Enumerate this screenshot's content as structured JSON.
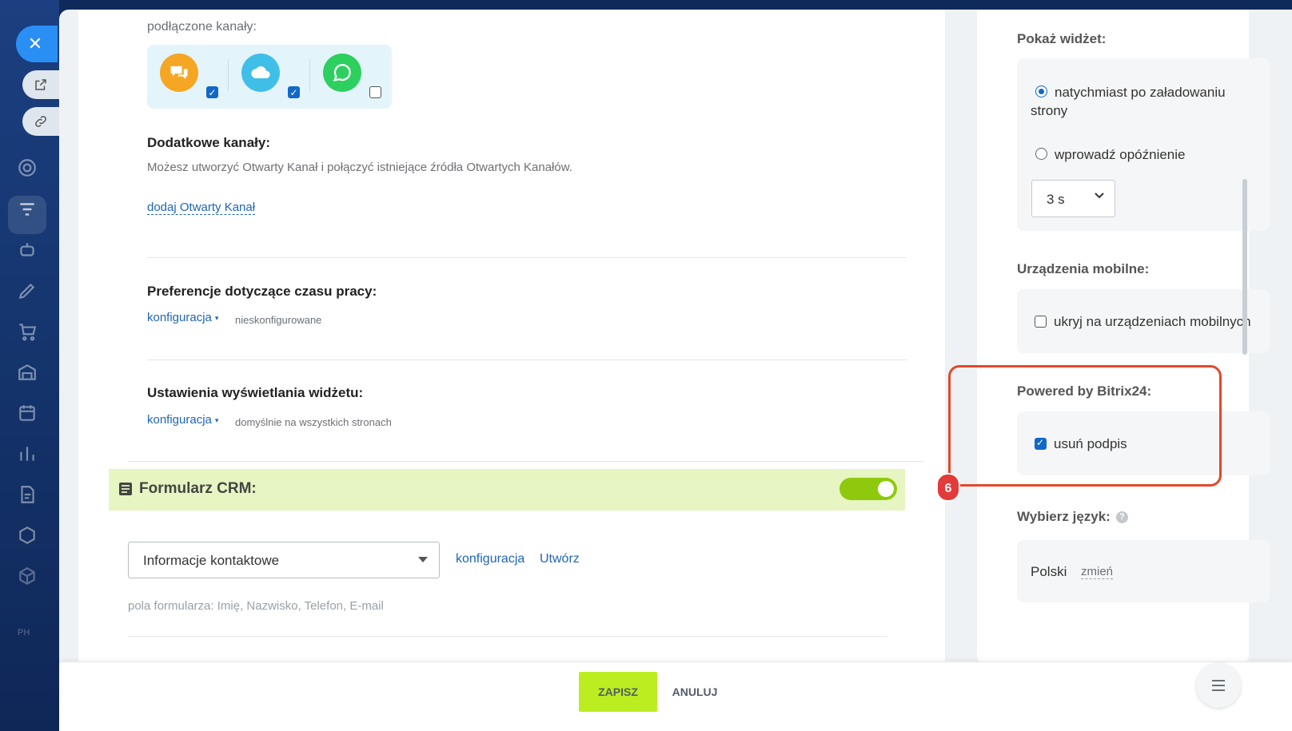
{
  "colors": {
    "accent_blue": "#2066b0",
    "toggle_green": "#8fc90d",
    "save_button": "#bbed21",
    "highlight_red": "#e0492c"
  },
  "left_rail": {
    "icons": [
      "close-icon",
      "external-link-icon",
      "link-icon",
      "target-icon",
      "funnel-icon",
      "robot-icon",
      "pencil-icon",
      "cart-icon",
      "warehouse-icon",
      "calendar-icon",
      "bar-chart-icon",
      "document-icon",
      "hexagon-icon",
      "cube-icon"
    ],
    "ph_label": "PH"
  },
  "channels": {
    "label": "podłączone kanały:",
    "items": [
      {
        "icon": "chat-icon",
        "color": "#f5a623",
        "checked": true
      },
      {
        "icon": "cloud-icon",
        "color": "#3fbfe8",
        "checked": true
      },
      {
        "icon": "whatsapp-icon",
        "color": "#2dcf5f",
        "checked": false
      }
    ]
  },
  "additional_channels": {
    "title": "Dodatkowe kanały:",
    "description": "Możesz utworzyć Otwarty Kanał i połączyć istniejące źródła Otwartych Kanałów.",
    "add_link": "dodaj Otwarty Kanał"
  },
  "work_time": {
    "title": "Preferencje dotyczące czasu pracy:",
    "config_link": "konfiguracja",
    "status": "nieskonfigurowane"
  },
  "display_settings": {
    "title": "Ustawienia wyświetlania widżetu:",
    "config_link": "konfiguracja",
    "status": "domyślnie na wszystkich stronach"
  },
  "crm_form": {
    "title": "Formularz CRM:",
    "enabled": true,
    "selected_form": "Informacje kontaktowe",
    "config_link": "konfiguracja",
    "create_link": "Utwórz",
    "fields_text": "pola formularza: Imię, Nazwisko, Telefon, E-mail"
  },
  "right_panel": {
    "show_widget": {
      "title": "Pokaż widżet:",
      "option_immediate": "natychmiast po załadowaniu strony",
      "option_delay": "wprowadź opóźnienie",
      "selected": "immediate",
      "delay_value": "3 s"
    },
    "mobile": {
      "title": "Urządzenia mobilne:",
      "hide_label": "ukryj na urządzeniach mobilnych",
      "hide_checked": false
    },
    "powered_by": {
      "title": "Powered by Bitrix24:",
      "remove_label": "usuń podpis",
      "remove_checked": true
    },
    "language": {
      "title": "Wybierz język:",
      "value": "Polski",
      "change_link": "zmień"
    }
  },
  "annotation_badge": "6",
  "footer": {
    "save_label": "ZAPISZ",
    "cancel_label": "ANULUJ"
  }
}
